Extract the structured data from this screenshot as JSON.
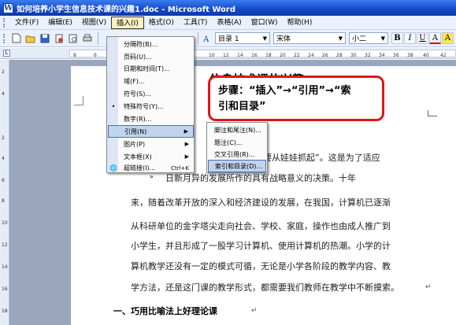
{
  "window": {
    "title": "如何培养小学生信息技术课的兴趣1.doc - Microsoft Word",
    "app_icon_letter": "W"
  },
  "menubar": {
    "items": [
      {
        "label": "文件(F)"
      },
      {
        "label": "编辑(E)"
      },
      {
        "label": "视图(V)"
      },
      {
        "label": "插入(I)",
        "active": true
      },
      {
        "label": "格式(O)"
      },
      {
        "label": "工具(T)"
      },
      {
        "label": "表格(A)"
      },
      {
        "label": "窗口(W)"
      },
      {
        "label": "帮助(H)"
      }
    ]
  },
  "toolbar": {
    "style": "目录 1",
    "font": "宋体",
    "size": "小二",
    "bold": "B",
    "italic": "I",
    "underline": "U",
    "font_color": "A",
    "highlight": "A"
  },
  "ruler": {
    "tab_marker": "L",
    "numbers": [
      "8",
      "6",
      "10",
      "12",
      "14",
      "16",
      "18",
      "20",
      "22",
      "24",
      "26",
      "28",
      "30",
      "32",
      "34",
      "36",
      "38",
      "40",
      "42"
    ]
  },
  "vruler": {
    "numbers": [
      "2",
      "4",
      "2",
      "4",
      "6",
      "8",
      "10",
      "12",
      "14",
      "16",
      "18"
    ]
  },
  "insert_menu": {
    "items": [
      {
        "label": "分隔符(B)..."
      },
      {
        "label": "页码(U)..."
      },
      {
        "label": "日期和时间(T)..."
      },
      {
        "label": "域(F)..."
      },
      {
        "label": "符号(S)..."
      },
      {
        "label": "特殊符号(Y)...",
        "icon": "•"
      },
      {
        "label": "数字(R)..."
      },
      {
        "label": "引用(N)",
        "has_submenu": true,
        "highlighted": true
      },
      {
        "label": "图片(P)",
        "has_submenu": true
      },
      {
        "label": "文本框(X)",
        "has_submenu": true
      },
      {
        "label": "超链接(I)...",
        "shortcut": "Ctrl+K",
        "icon": "🌐"
      }
    ],
    "more_label": "»"
  },
  "reference_submenu": {
    "items": [
      {
        "label": "脚注和尾注(N)..."
      },
      {
        "label": "题注(C)..."
      },
      {
        "label": "交叉引用(R)..."
      },
      {
        "label": "索引和目录(D)...",
        "highlighted": true
      }
    ]
  },
  "callout": {
    "line1": "步骤：“插入”→“引用”→“索",
    "line2": "引和目录”",
    "border_color": "#e01616"
  },
  "document": {
    "heading": "信息技术课的兴趣",
    "lines": [
      "算机要从娃娃抓起”。这是为了适应",
      "日新月异的发展所作的具有战略意义的决策。十年",
      "来，随着改革开放的深入和经济建设的发展，在我国，计算机已逐渐",
      "从科研单位的金字塔尖走向社会、学校、家庭，操作也由成人推广到",
      "小学生，并且形成了一股学习计算机、使用计算机的热潮。小学的计",
      "算机教学还没有一定的模式可循，无论是小学各阶段的教学内容、教",
      "学方法，还是这门课的教学形式，都需要我们教师在教学中不断摸索。"
    ],
    "section_title": "一、巧用比喻法上好理论课",
    "paragraph_mark": "↵"
  }
}
